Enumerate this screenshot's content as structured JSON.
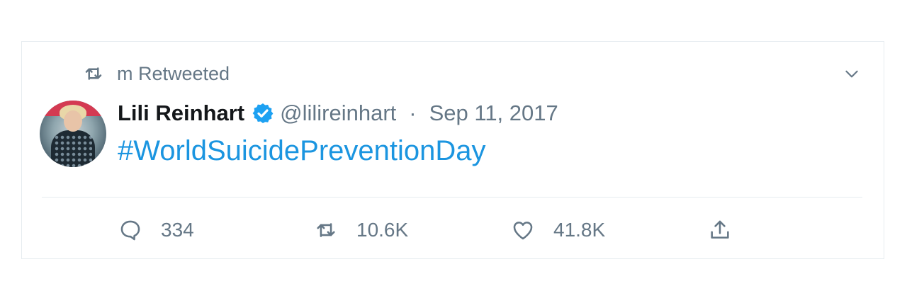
{
  "retweet_context": {
    "label": "m Retweeted",
    "icon": "retweet-icon"
  },
  "tweet": {
    "display_name": "Lili Reinhart",
    "verified_icon": "verified-badge-icon",
    "handle": "@lilireinhart",
    "separator": "·",
    "date": "Sep 11, 2017",
    "text": "#WorldSuicidePreventionDay"
  },
  "actions": {
    "reply": {
      "count": "334",
      "icon": "reply-icon"
    },
    "retweet": {
      "count": "10.6K",
      "icon": "retweet-icon"
    },
    "like": {
      "count": "41.8K",
      "icon": "heart-icon"
    },
    "share": {
      "icon": "share-icon"
    }
  },
  "menu": {
    "icon": "chevron-down-icon"
  },
  "colors": {
    "accent": "#1b95e0",
    "secondary_text": "#657786",
    "primary_text": "#14171a",
    "border": "#e6ecf0",
    "verified": "#1da1f2"
  }
}
